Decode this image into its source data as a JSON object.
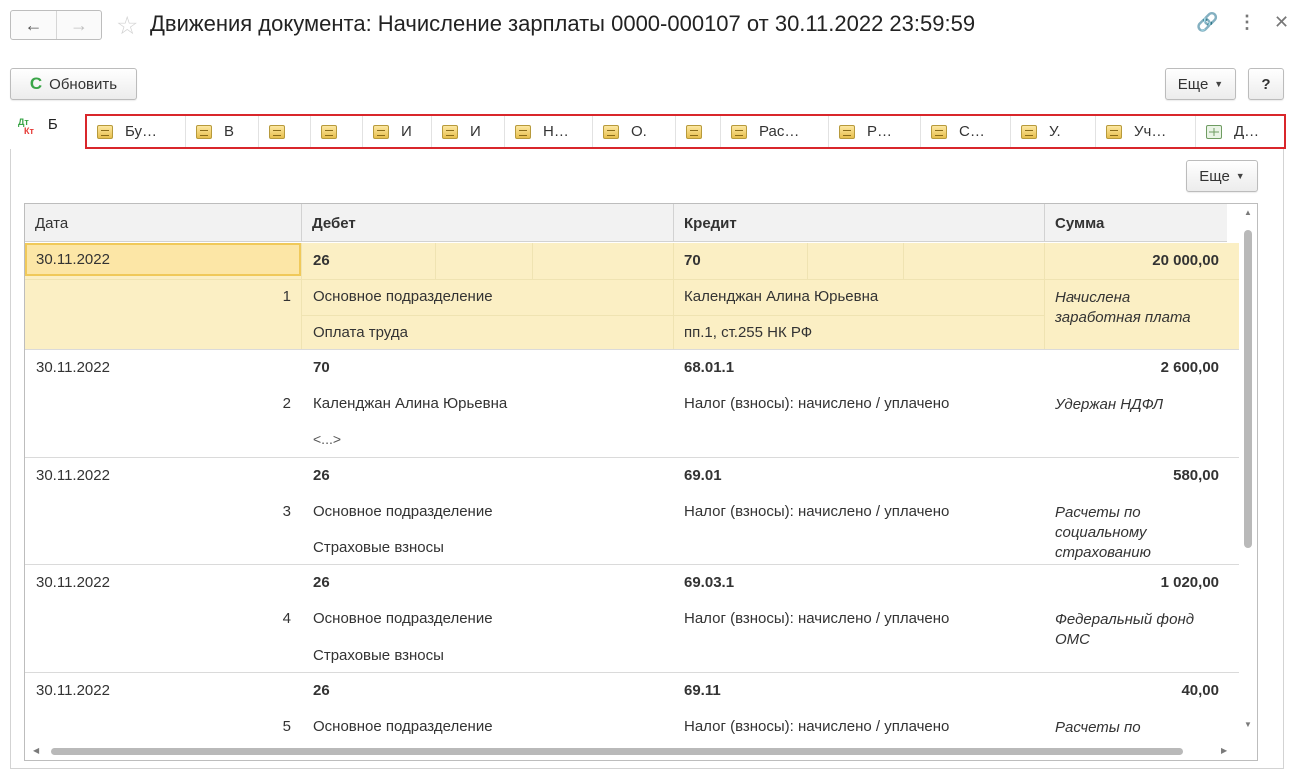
{
  "window": {
    "title": "Движения документа: Начисление зарплаты 0000-000107 от 30.11.2022 23:59:59",
    "back_icon": "←",
    "forward_icon": "→",
    "star_icon": "☆",
    "link_icon": "🔗",
    "more_icon": "⋮",
    "close_icon": "✕"
  },
  "toolbar": {
    "refresh_icon": "C",
    "refresh_label": "Обновить",
    "more_label": "Еще",
    "help_label": "?"
  },
  "tabs": {
    "first_label": "Б",
    "dt": "Дт",
    "kt": "Кт",
    "items": [
      {
        "label": "Бу…"
      },
      {
        "label": "В"
      },
      {
        "label": ""
      },
      {
        "label": ""
      },
      {
        "label": "И"
      },
      {
        "label": "И"
      },
      {
        "label": "Н…"
      },
      {
        "label": "О."
      },
      {
        "label": ""
      },
      {
        "label": "Рас…"
      },
      {
        "label": "Р…"
      },
      {
        "label": "С…"
      },
      {
        "label": "У."
      },
      {
        "label": "Уч…"
      },
      {
        "label": "Д…"
      }
    ]
  },
  "table": {
    "more_label": "Еще",
    "columns": {
      "date": "Дата",
      "debit": "Дебет",
      "credit": "Кредит",
      "sum": "Сумма"
    },
    "rows": [
      {
        "date": "30.11.2022",
        "num": "1",
        "debit_acc": "26",
        "debit_sub1": "Основное подразделение",
        "debit_sub2": "Оплата труда",
        "credit_acc": "70",
        "credit_sub1": "Календжан Алина Юрьевна",
        "credit_sub2": "пп.1, ст.255 НК РФ",
        "sum": "20 000,00",
        "content": "Начислена заработная плата"
      },
      {
        "date": "30.11.2022",
        "num": "2",
        "debit_acc": "70",
        "debit_sub1": "Календжан Алина Юрьевна",
        "debit_sub2": "<...>",
        "credit_acc": "68.01.1",
        "credit_sub1": "Налог (взносы): начислено / уплачено",
        "credit_sub2": "",
        "sum": "2 600,00",
        "content": "Удержан НДФЛ"
      },
      {
        "date": "30.11.2022",
        "num": "3",
        "debit_acc": "26",
        "debit_sub1": "Основное подразделение",
        "debit_sub2": "Страховые взносы",
        "credit_acc": "69.01",
        "credit_sub1": "Налог (взносы): начислено / уплачено",
        "credit_sub2": "",
        "sum": "580,00",
        "content": "Расчеты по социальному страхованию"
      },
      {
        "date": "30.11.2022",
        "num": "4",
        "debit_acc": "26",
        "debit_sub1": "Основное подразделение",
        "debit_sub2": "Страховые взносы",
        "credit_acc": "69.03.1",
        "credit_sub1": "Налог (взносы): начислено / уплачено",
        "credit_sub2": "",
        "sum": "1 020,00",
        "content": "Федеральный фонд ОМС"
      },
      {
        "date": "30.11.2022",
        "num": "5",
        "debit_acc": "26",
        "debit_sub1": "Основное подразделение",
        "debit_sub2": "",
        "credit_acc": "69.11",
        "credit_sub1": "Налог (взносы): начислено / уплачено",
        "credit_sub2": "",
        "sum": "40,00",
        "content": "Расчеты по"
      }
    ]
  }
}
